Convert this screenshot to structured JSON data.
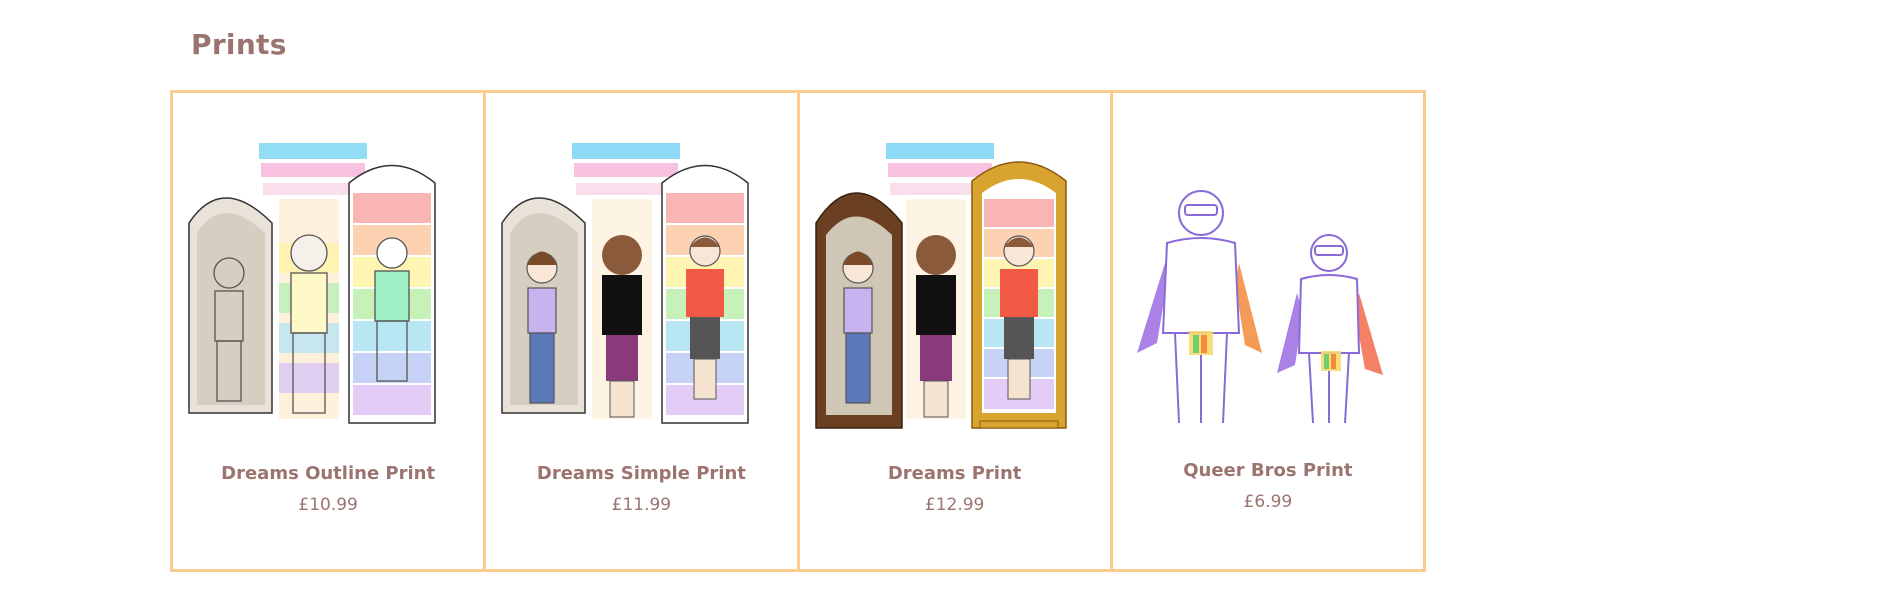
{
  "section": {
    "title": "Prints"
  },
  "colors": {
    "accent_border": "#fbcb8f",
    "text": "#9b7470"
  },
  "products": [
    {
      "name": "Dreams Outline Print",
      "price": "£10.99",
      "image": "dreams-outline-artwork"
    },
    {
      "name": "Dreams Simple Print",
      "price": "£11.99",
      "image": "dreams-simple-artwork"
    },
    {
      "name": "Dreams Print",
      "price": "£12.99",
      "image": "dreams-artwork"
    },
    {
      "name": "Queer Bros Print",
      "price": "£6.99",
      "image": "queer-bros-artwork"
    }
  ]
}
